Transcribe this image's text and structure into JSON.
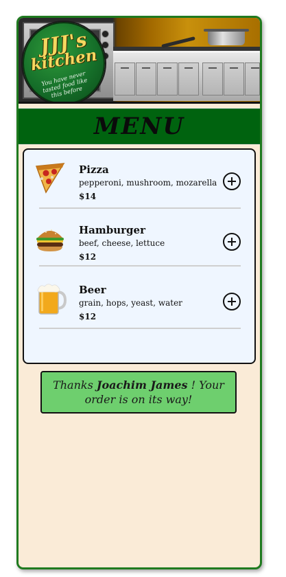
{
  "banner": {
    "logo_name_line1": "JJJ's",
    "logo_name_line2": "kitchen",
    "logo_tagline": "You have never tasted food like this before"
  },
  "menu": {
    "title": "MENU",
    "items": [
      {
        "name": "Pizza",
        "description": "pepperoni, mushroom, mozarella",
        "price": "$14",
        "icon": "pizza-slice-icon"
      },
      {
        "name": "Hamburger",
        "description": "beef, cheese, lettuce",
        "price": "$12",
        "icon": "hamburger-icon"
      },
      {
        "name": "Beer",
        "description": "grain, hops, yeast, water",
        "price": "$12",
        "icon": "beer-mug-icon"
      }
    ]
  },
  "confirmation": {
    "prefix": "Thanks",
    "user_name": "Joachim James",
    "suffix": "! Your order is on its way!"
  },
  "colors": {
    "frame_border": "#1f7a1f",
    "menu_bar": "#00630f",
    "background": "#faebd7",
    "card": "#eff6ff",
    "confirmation": "#6ecf6e"
  }
}
